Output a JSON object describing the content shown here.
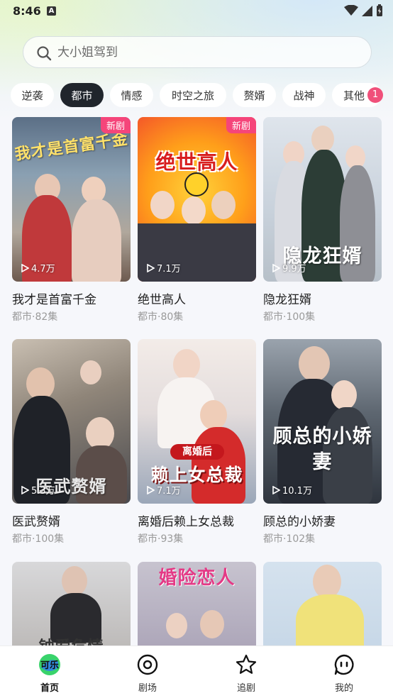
{
  "status_bar": {
    "time": "8:46",
    "notification_letter": "A"
  },
  "search": {
    "placeholder": "大小姐驾到"
  },
  "categories": [
    {
      "label": "逆袭",
      "active": false
    },
    {
      "label": "都市",
      "active": true
    },
    {
      "label": "情感",
      "active": false
    },
    {
      "label": "时空之旅",
      "active": false
    },
    {
      "label": "赘婿",
      "active": false
    },
    {
      "label": "战神",
      "active": false
    },
    {
      "label": "其他",
      "active": false
    }
  ],
  "categories_badge": "1",
  "dramas": [
    {
      "title": "我才是首富千金",
      "meta": "都市·82集",
      "views": "4.7万",
      "badge": "新剧",
      "poster_text": "我才是首富千金"
    },
    {
      "title": "绝世高人",
      "meta": "都市·80集",
      "views": "7.1万",
      "badge": "新剧",
      "poster_text": "绝世高人"
    },
    {
      "title": "隐龙狂婿",
      "meta": "都市·100集",
      "views": "9.9万",
      "badge": "",
      "poster_text": "隐龙狂婿"
    },
    {
      "title": "医武赘婿",
      "meta": "都市·100集",
      "views": "5.3万",
      "badge": "",
      "poster_text": "医武赘婿"
    },
    {
      "title": "离婚后赖上女总裁",
      "meta": "都市·93集",
      "views": "7.1万",
      "badge": "",
      "poster_text": "赖上女总裁",
      "poster_tag": "离婚后"
    },
    {
      "title": "顾总的小娇妻",
      "meta": "都市·102集",
      "views": "10.1万",
      "badge": "",
      "poster_text": "顾总的小娇妻"
    },
    {
      "title": "",
      "meta": "",
      "views": "",
      "badge": "",
      "poster_text": "钟爱危情"
    },
    {
      "title": "",
      "meta": "",
      "views": "",
      "badge": "",
      "poster_text": "婚险恋人"
    },
    {
      "title": "",
      "meta": "",
      "views": "",
      "badge": "",
      "poster_text": ""
    }
  ],
  "nav": [
    {
      "label": "首页",
      "icon": "home-logo-icon",
      "active": true
    },
    {
      "label": "剧场",
      "icon": "theater-icon",
      "active": false
    },
    {
      "label": "追剧",
      "icon": "star-icon",
      "active": false
    },
    {
      "label": "我的",
      "icon": "profile-chat-icon",
      "active": false
    }
  ],
  "colors": {
    "accent_badge": "#f5457a",
    "chip_active": "#20252c",
    "logo_green": "#39d36b"
  }
}
